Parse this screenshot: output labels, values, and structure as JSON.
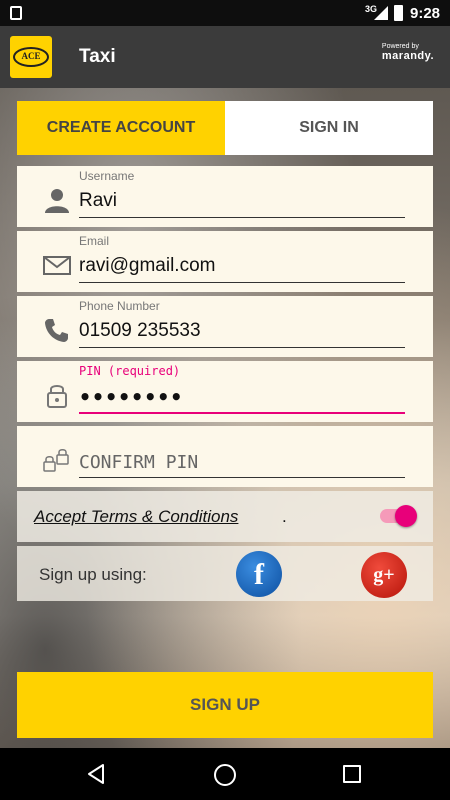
{
  "status_bar": {
    "network": "3G",
    "time": "9:28"
  },
  "app_bar": {
    "logo_text": "ACE",
    "title": "Taxi",
    "powered_by": "Powered by",
    "brand": "marandy."
  },
  "tabs": [
    {
      "label": "CREATE ACCOUNT",
      "active": true
    },
    {
      "label": "SIGN IN",
      "active": false
    }
  ],
  "form": {
    "username": {
      "label": "Username",
      "value": "Ravi",
      "icon": "person-icon"
    },
    "email": {
      "label": "Email",
      "value": "ravi@gmail.com",
      "icon": "envelope-icon"
    },
    "phone": {
      "label": "Phone Number",
      "value": "01509 235533",
      "icon": "phone-icon"
    },
    "pin": {
      "label": "PIN (required)",
      "value": "••••••••",
      "icon": "lock-icon"
    },
    "confirm_pin": {
      "placeholder": "CONFIRM PIN",
      "icon": "double-lock-icon"
    }
  },
  "terms": {
    "link_text": "Accept Terms & Conditions",
    "suffix": ".",
    "toggle_on": true
  },
  "social": {
    "label": "Sign up using:",
    "facebook": "f",
    "google": "g+"
  },
  "signup_button": {
    "label": "SIGN UP"
  },
  "colors": {
    "accent": "#ffd200",
    "pink": "#e8007a",
    "field_bg": "#fdf8ea"
  }
}
